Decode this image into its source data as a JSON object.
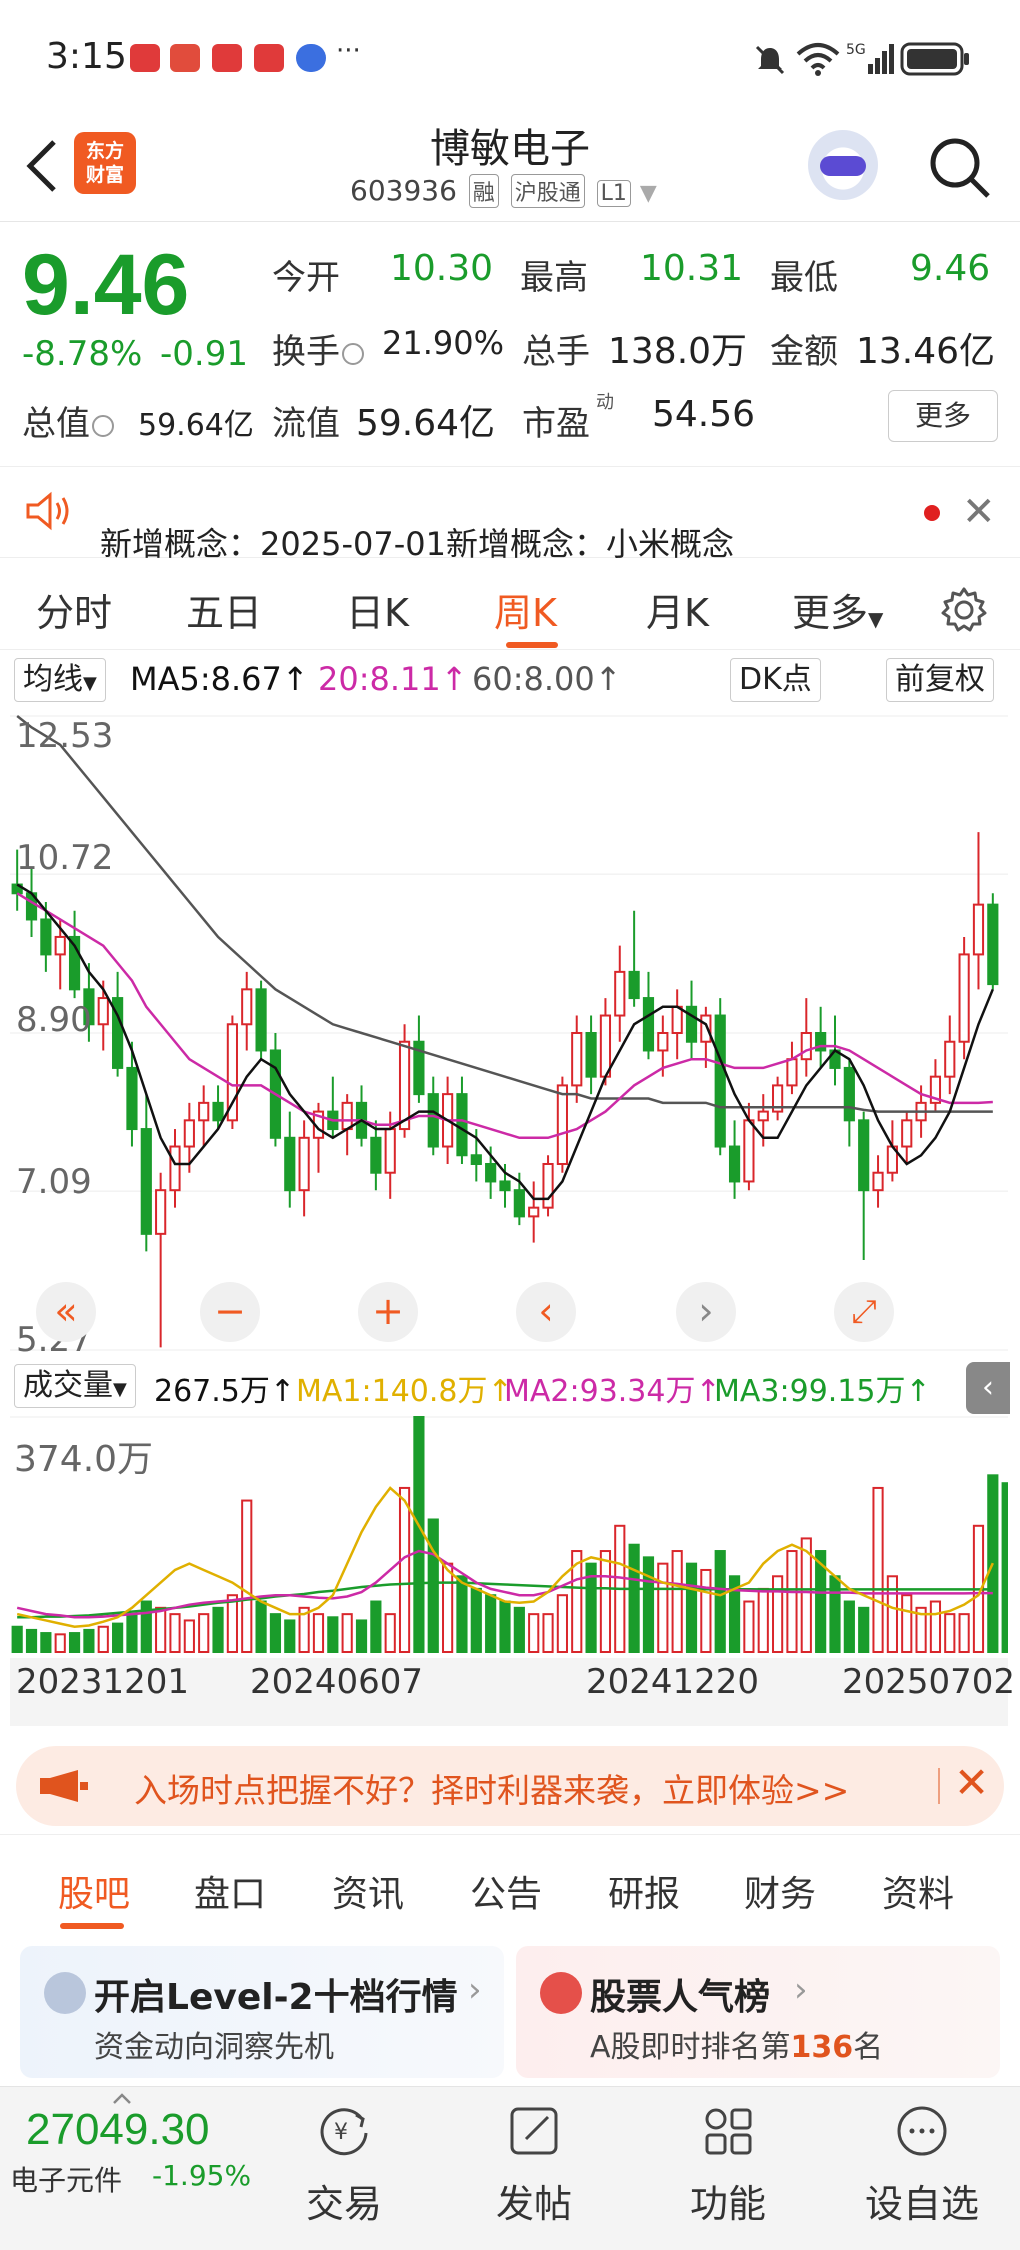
{
  "status_bar": {
    "time": "3:15",
    "dots": "···"
  },
  "header": {
    "logo_text_1": "东方",
    "logo_text_2": "财富",
    "stock_name": "博敏电子",
    "stock_code": "603936",
    "tag_margin": "融",
    "tag_connect": "沪股通",
    "tag_level": "L1"
  },
  "quote": {
    "price": "9.46",
    "change_pct": "-8.78%",
    "change_amt": "-0.91",
    "open_label": "今开",
    "open": "10.30",
    "high_label": "最高",
    "high": "10.31",
    "low_label": "最低",
    "low": "9.46",
    "turnover_label": "换手",
    "turnover": "21.90%",
    "volume_label": "总手",
    "volume": "138.0万",
    "amount_label": "金额",
    "amount": "13.46亿",
    "mktcap_label": "总值",
    "mktcap": "59.64亿",
    "float_label": "流值",
    "float_cap": "59.64亿",
    "pe_label": "市盈",
    "pe_sup": "动",
    "pe": "54.56",
    "more_label": "更多"
  },
  "notice": {
    "text": "新增概念：2025-07-01新增概念：小米概念"
  },
  "period_tabs": [
    "分时",
    "五日",
    "日K",
    "周K",
    "月K",
    "更多"
  ],
  "active_period": "周K",
  "ma_bar": {
    "dropdown": "均线",
    "ma5": "MA5:8.67↑",
    "ma20": "20:8.11↑",
    "ma60": "60:8.00↑",
    "dk_label": "DK点",
    "adjust_label": "前复权"
  },
  "kchart_axis": {
    "y_labels": [
      "12.53",
      "10.72",
      "8.90",
      "7.09",
      "5.27"
    ]
  },
  "controls": {
    "rewind": "«",
    "zoom_out": "−",
    "zoom_in": "+",
    "prev": "‹",
    "next": "›",
    "expand": "⤢"
  },
  "vol_bar": {
    "dropdown": "成交量",
    "vol": "267.5万↑",
    "ma1": "MA1:140.8万↑",
    "ma2": "MA2:93.34万↑",
    "ma3": "MA3:99.15万↑",
    "collapse": "‹"
  },
  "vchart_axis": {
    "max_label": "374.0万"
  },
  "dates": [
    "20231201",
    "20240607",
    "20241220",
    "20250702"
  ],
  "promo": {
    "text": "入场时点把握不好？择时利器来袭，立即体验>>",
    "close": "✕"
  },
  "bottom_tabs": [
    "股吧",
    "盘口",
    "资讯",
    "公告",
    "研报",
    "财务",
    "资料"
  ],
  "active_bottom_tab": "股吧",
  "cards": {
    "l2_title": "开启Level-2十档行情",
    "l2_sub": "资金动向洞察先机",
    "pop_title": "股票人气榜",
    "pop_sub_prefix": "A股即时排名第",
    "pop_rank": "136",
    "pop_sub_suffix": "名"
  },
  "bottom_nav": {
    "index_value": "27049.30",
    "index_name": "电子元件",
    "index_pct": "-1.95%",
    "items": [
      "交易",
      "发帖",
      "功能",
      "设自选"
    ]
  },
  "colors": {
    "up": "#d9262b",
    "down": "#1a9c2b",
    "accent": "#f05a22",
    "ma5": "#111111",
    "ma20": "#cc2aa6",
    "ma60": "#555555"
  },
  "chart_data": {
    "type": "candlestick",
    "ylim": [
      5.27,
      12.53
    ],
    "y_ticks": [
      12.53,
      10.72,
      8.9,
      7.09,
      5.27
    ],
    "candles": [
      [
        10.6,
        11.0,
        10.3,
        10.5
      ],
      [
        10.5,
        10.8,
        10.0,
        10.2
      ],
      [
        10.2,
        10.4,
        9.6,
        9.8
      ],
      [
        9.8,
        10.2,
        9.4,
        10.0
      ],
      [
        10.0,
        10.3,
        9.3,
        9.4
      ],
      [
        9.4,
        9.7,
        8.8,
        9.0
      ],
      [
        9.0,
        9.5,
        8.7,
        9.3
      ],
      [
        9.3,
        9.6,
        8.4,
        8.5
      ],
      [
        8.5,
        8.8,
        7.6,
        7.8
      ],
      [
        7.8,
        8.2,
        6.4,
        6.6
      ],
      [
        6.6,
        7.3,
        5.3,
        7.1
      ],
      [
        7.1,
        7.8,
        6.9,
        7.6
      ],
      [
        7.6,
        8.1,
        7.3,
        7.9
      ],
      [
        7.9,
        8.3,
        7.6,
        8.1
      ],
      [
        8.1,
        8.3,
        7.8,
        7.9
      ],
      [
        7.9,
        9.1,
        7.8,
        9.0
      ],
      [
        9.0,
        9.6,
        8.7,
        9.4
      ],
      [
        9.4,
        9.5,
        8.6,
        8.7
      ],
      [
        8.7,
        8.9,
        7.6,
        7.7
      ],
      [
        7.7,
        8.0,
        6.9,
        7.1
      ],
      [
        7.1,
        7.9,
        6.8,
        7.7
      ],
      [
        7.7,
        8.1,
        7.3,
        8.0
      ],
      [
        8.0,
        8.4,
        7.7,
        7.8
      ],
      [
        7.8,
        8.2,
        7.5,
        8.1
      ],
      [
        8.1,
        8.3,
        7.6,
        7.7
      ],
      [
        7.7,
        7.9,
        7.1,
        7.3
      ],
      [
        7.3,
        8.0,
        7.0,
        7.8
      ],
      [
        7.8,
        9.0,
        7.7,
        8.8
      ],
      [
        8.8,
        9.1,
        8.1,
        8.2
      ],
      [
        8.2,
        8.4,
        7.5,
        7.6
      ],
      [
        7.6,
        8.4,
        7.4,
        8.2
      ],
      [
        8.2,
        8.4,
        7.4,
        7.5
      ],
      [
        7.5,
        7.8,
        7.2,
        7.4
      ],
      [
        7.4,
        7.6,
        7.0,
        7.2
      ],
      [
        7.2,
        7.4,
        6.9,
        7.1
      ],
      [
        7.1,
        7.3,
        6.7,
        6.8
      ],
      [
        6.8,
        7.2,
        6.5,
        6.9
      ],
      [
        6.9,
        7.5,
        6.8,
        7.4
      ],
      [
        7.4,
        8.4,
        7.3,
        8.3
      ],
      [
        8.3,
        9.1,
        8.1,
        8.9
      ],
      [
        8.9,
        9.1,
        8.2,
        8.4
      ],
      [
        8.4,
        9.3,
        8.3,
        9.1
      ],
      [
        9.1,
        9.9,
        8.8,
        9.6
      ],
      [
        9.6,
        10.3,
        9.2,
        9.3
      ],
      [
        9.3,
        9.6,
        8.6,
        8.7
      ],
      [
        8.7,
        9.1,
        8.4,
        8.9
      ],
      [
        8.9,
        9.4,
        8.6,
        9.2
      ],
      [
        9.2,
        9.5,
        8.6,
        8.8
      ],
      [
        8.8,
        9.2,
        8.5,
        9.1
      ],
      [
        9.1,
        9.3,
        7.5,
        7.6
      ],
      [
        7.6,
        7.9,
        7.0,
        7.2
      ],
      [
        7.2,
        8.1,
        7.1,
        7.9
      ],
      [
        7.9,
        8.2,
        7.6,
        8.0
      ],
      [
        8.0,
        8.4,
        7.9,
        8.3
      ],
      [
        8.3,
        8.8,
        8.2,
        8.6
      ],
      [
        8.6,
        9.3,
        8.4,
        8.9
      ],
      [
        8.9,
        9.2,
        8.5,
        8.7
      ],
      [
        8.7,
        9.1,
        8.3,
        8.5
      ],
      [
        8.5,
        8.6,
        7.6,
        7.9
      ],
      [
        7.9,
        8.0,
        6.3,
        7.1
      ],
      [
        7.1,
        7.5,
        6.9,
        7.3
      ],
      [
        7.3,
        7.9,
        7.2,
        7.6
      ],
      [
        7.6,
        8.0,
        7.4,
        7.9
      ],
      [
        7.9,
        8.3,
        7.7,
        8.1
      ],
      [
        8.1,
        8.6,
        8.0,
        8.4
      ],
      [
        8.4,
        9.1,
        8.2,
        8.8
      ],
      [
        8.8,
        10.0,
        8.6,
        9.8
      ],
      [
        9.8,
        11.2,
        9.4,
        10.37
      ],
      [
        10.37,
        10.5,
        9.4,
        9.46
      ]
    ],
    "ma5": [
      10.6,
      10.5,
      10.3,
      10.1,
      9.9,
      9.6,
      9.4,
      9.1,
      8.7,
      8.2,
      7.7,
      7.4,
      7.4,
      7.6,
      7.8,
      8.1,
      8.4,
      8.6,
      8.5,
      8.2,
      8.0,
      7.8,
      7.7,
      7.8,
      7.9,
      7.8,
      7.8,
      7.9,
      8.0,
      8.0,
      7.9,
      7.8,
      7.7,
      7.5,
      7.3,
      7.2,
      7.0,
      7.0,
      7.2,
      7.6,
      8.0,
      8.4,
      8.7,
      9.0,
      9.1,
      9.2,
      9.2,
      9.1,
      9.0,
      8.6,
      8.2,
      7.9,
      7.7,
      7.7,
      8.0,
      8.3,
      8.5,
      8.7,
      8.6,
      8.3,
      7.9,
      7.6,
      7.4,
      7.5,
      7.7,
      8.0,
      8.5,
      9.0,
      9.4
    ],
    "ma20": [
      10.5,
      10.4,
      10.3,
      10.2,
      10.1,
      10.0,
      9.9,
      9.7,
      9.5,
      9.2,
      9.0,
      8.8,
      8.6,
      8.5,
      8.4,
      8.3,
      8.3,
      8.3,
      8.2,
      8.1,
      8.0,
      7.95,
      7.9,
      7.9,
      7.9,
      7.85,
      7.85,
      7.9,
      7.95,
      7.95,
      7.9,
      7.9,
      7.85,
      7.8,
      7.75,
      7.7,
      7.7,
      7.7,
      7.75,
      7.8,
      7.9,
      8.0,
      8.15,
      8.3,
      8.4,
      8.5,
      8.55,
      8.6,
      8.6,
      8.55,
      8.5,
      8.5,
      8.5,
      8.55,
      8.6,
      8.7,
      8.75,
      8.75,
      8.7,
      8.6,
      8.5,
      8.4,
      8.3,
      8.2,
      8.15,
      8.1,
      8.1,
      8.1,
      8.11
    ],
    "ma60": [
      12.53,
      12.4,
      12.3,
      12.2,
      12.0,
      11.8,
      11.6,
      11.4,
      11.2,
      11.0,
      10.8,
      10.6,
      10.4,
      10.2,
      10.0,
      9.85,
      9.7,
      9.55,
      9.4,
      9.3,
      9.2,
      9.1,
      9.0,
      8.95,
      8.9,
      8.85,
      8.8,
      8.75,
      8.7,
      8.65,
      8.6,
      8.55,
      8.5,
      8.45,
      8.4,
      8.35,
      8.3,
      8.25,
      8.2,
      8.2,
      8.15,
      8.15,
      8.15,
      8.15,
      8.15,
      8.1,
      8.1,
      8.1,
      8.1,
      8.05,
      8.05,
      8.05,
      8.05,
      8.05,
      8.05,
      8.05,
      8.05,
      8.05,
      8.05,
      8.02,
      8.0,
      8.0,
      8.0,
      8.0,
      8.0,
      8.0,
      8.0,
      8.0,
      8.0
    ],
    "volume_max": 374.0,
    "volumes": [
      40,
      35,
      30,
      28,
      30,
      35,
      40,
      45,
      60,
      80,
      70,
      60,
      50,
      60,
      70,
      90,
      240,
      80,
      60,
      50,
      70,
      60,
      55,
      60,
      50,
      80,
      60,
      260,
      374,
      210,
      140,
      120,
      100,
      90,
      80,
      70,
      60,
      60,
      90,
      160,
      140,
      160,
      200,
      170,
      150,
      140,
      160,
      140,
      130,
      160,
      120,
      80,
      100,
      120,
      160,
      180,
      160,
      120,
      80,
      70,
      260,
      120,
      90,
      70,
      80,
      60,
      60,
      200,
      280,
      267.5
    ],
    "vol_ma1": [
      60,
      55,
      50,
      45,
      40,
      42,
      48,
      55,
      70,
      90,
      110,
      130,
      140,
      130,
      120,
      110,
      95,
      80,
      70,
      60,
      60,
      70,
      90,
      140,
      190,
      230,
      260,
      240,
      200,
      160,
      130,
      110,
      100,
      90,
      80,
      78,
      80,
      95,
      120,
      140,
      150,
      145,
      140,
      130,
      120,
      110,
      105,
      100,
      95,
      90,
      100,
      110,
      140,
      160,
      170,
      160,
      140,
      120,
      100,
      90,
      80,
      70,
      65,
      60,
      60,
      65,
      75,
      90,
      140.8
    ],
    "vol_ma2": [
      70,
      65,
      60,
      58,
      55,
      55,
      56,
      58,
      60,
      62,
      65,
      70,
      75,
      78,
      80,
      82,
      85,
      88,
      90,
      90,
      88,
      86,
      85,
      88,
      95,
      110,
      130,
      150,
      160,
      155,
      140,
      125,
      110,
      100,
      95,
      90,
      90,
      95,
      105,
      115,
      120,
      120,
      118,
      115,
      112,
      110,
      108,
      105,
      102,
      100,
      98,
      97,
      96,
      96,
      95,
      95,
      94,
      94,
      94,
      93,
      93,
      93,
      93,
      93,
      93,
      93,
      93,
      93.34,
      93.34
    ],
    "vol_ma3": [
      55,
      55,
      56,
      56,
      57,
      58,
      60,
      62,
      64,
      66,
      68,
      70,
      72,
      75,
      78,
      80,
      83,
      85,
      88,
      90,
      92,
      95,
      97,
      100,
      103,
      105,
      107,
      108,
      109,
      110,
      110,
      110,
      109,
      108,
      107,
      106,
      105,
      104,
      103,
      102,
      101,
      101,
      100,
      100,
      100,
      100,
      100,
      100,
      99.5,
      99.5,
      99.4,
      99.4,
      99.3,
      99.3,
      99.3,
      99.2,
      99.2,
      99.2,
      99.2,
      99.2,
      99.15,
      99.15,
      99.15,
      99.15,
      99.15,
      99.15,
      99.15,
      99.15,
      99.15
    ]
  }
}
